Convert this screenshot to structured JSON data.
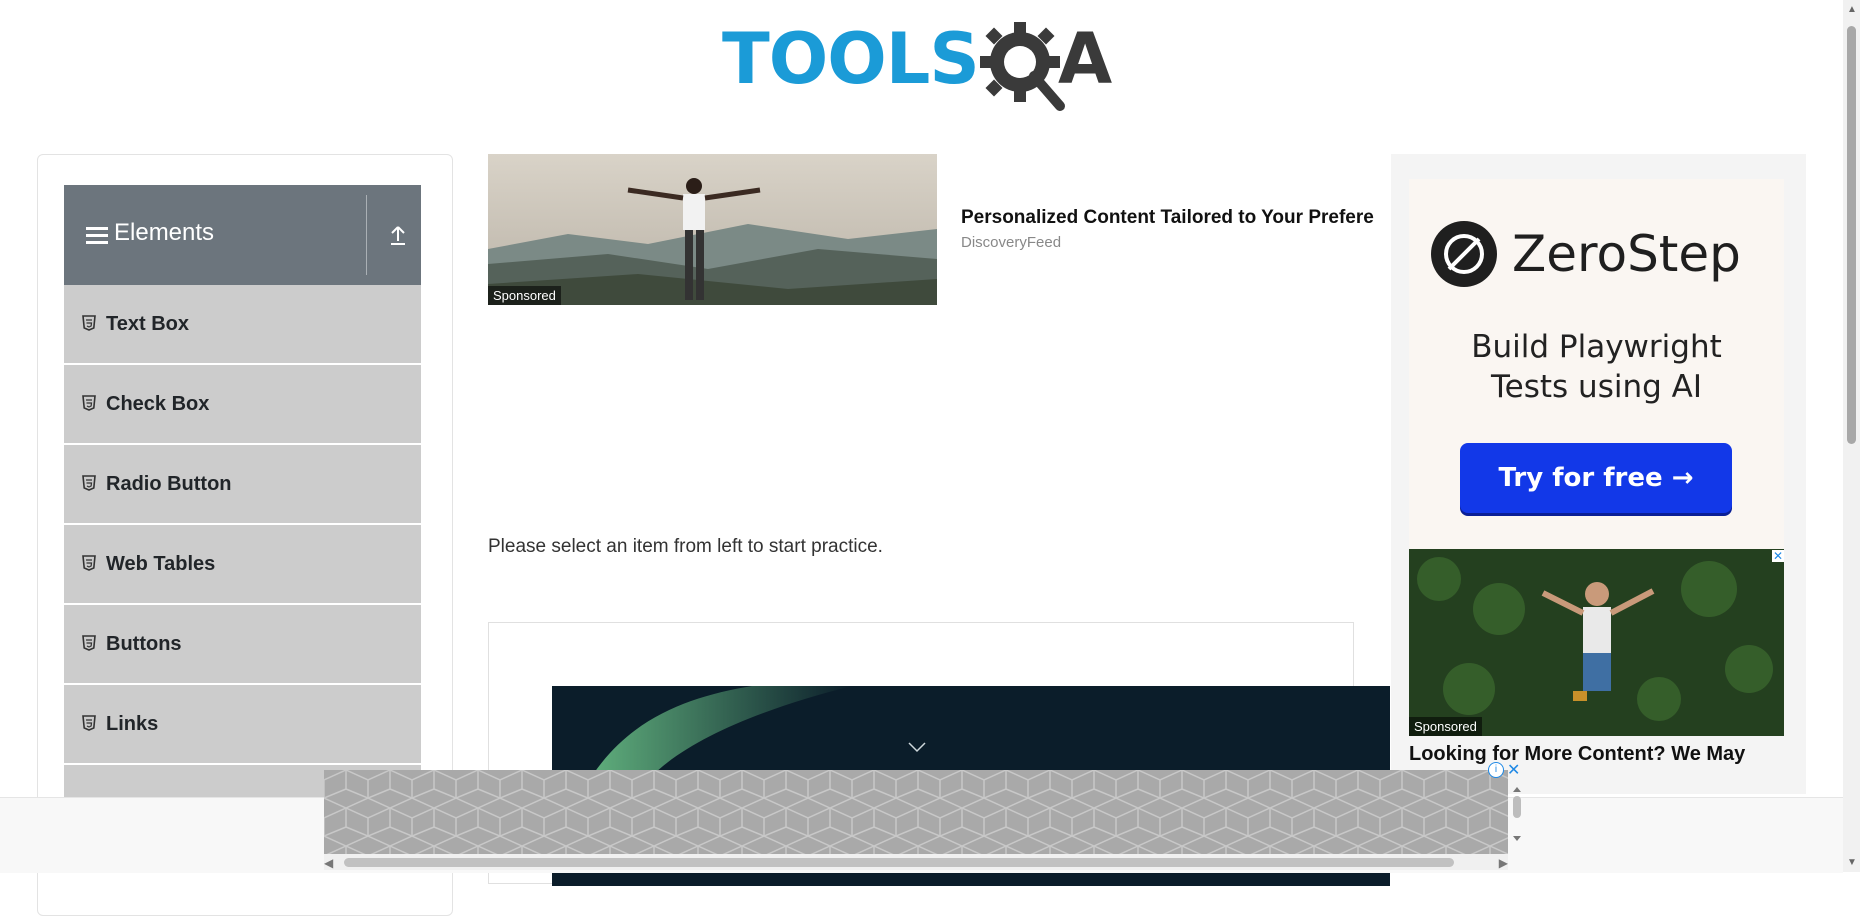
{
  "header": {
    "logo_text_blue": "TOOLS",
    "logo_text_dark": "A"
  },
  "sidebar": {
    "group_title": "Elements",
    "items": [
      {
        "label": "Text Box"
      },
      {
        "label": "Check Box"
      },
      {
        "label": "Radio Button"
      },
      {
        "label": "Web Tables"
      },
      {
        "label": "Buttons"
      },
      {
        "label": "Links"
      }
    ]
  },
  "ad_top": {
    "sponsored": "Sponsored",
    "title": "Personalized Content Tailored to Your Prefere",
    "source": "DiscoveryFeed"
  },
  "main": {
    "instruction": "Please select an item from left to start practice."
  },
  "ad_right": {
    "brand": "ZeroStep",
    "headline_line1": "Build Playwright",
    "headline_line2": "Tests using AI",
    "cta": "Try for free →",
    "sponsored": "Sponsored",
    "title": "Looking for More Content? We May     You Want"
  },
  "colors": {
    "accent_blue": "#1b9bd7",
    "sidebar_header": "#6c757d",
    "menu_item": "#cccccc",
    "cta_blue": "#1238e8"
  }
}
